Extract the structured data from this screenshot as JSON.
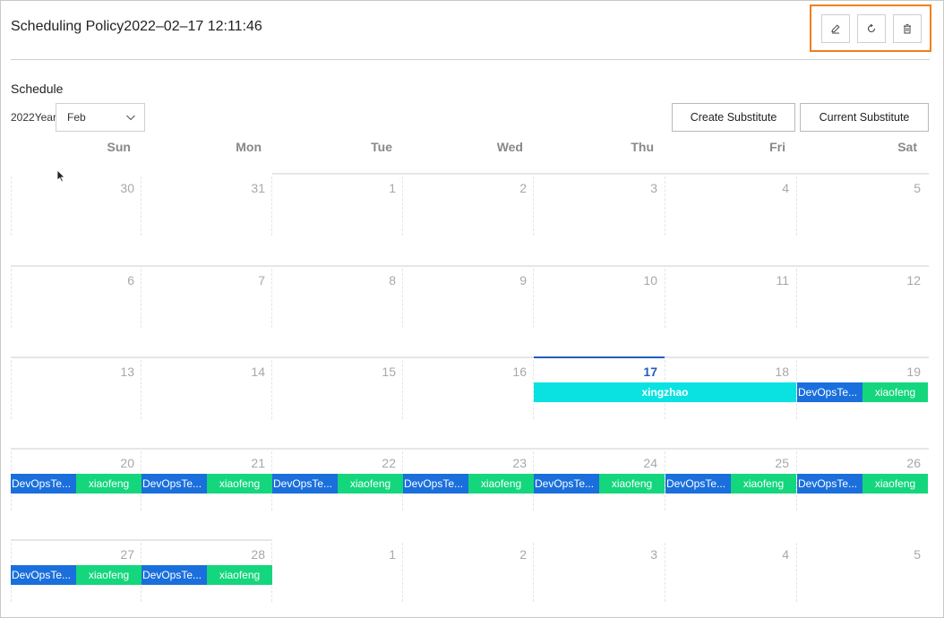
{
  "header": {
    "title": "Scheduling Policy2022–02–17 12:11:46",
    "actions": [
      {
        "name": "edit-button",
        "icon": "edit-icon"
      },
      {
        "name": "refresh-button",
        "icon": "refresh-icon"
      },
      {
        "name": "delete-button",
        "icon": "trash-icon"
      }
    ]
  },
  "schedule": {
    "label": "Schedule",
    "year_label": "2022Years",
    "month_value": "Feb",
    "create_substitute": "Create Substitute",
    "current_substitute": "Current Substitute",
    "weekdays": [
      "Sun",
      "Mon",
      "Tue",
      "Wed",
      "Thu",
      "Fri",
      "Sat"
    ],
    "weeks": [
      [
        "30",
        "31",
        "1",
        "2",
        "3",
        "4",
        "5"
      ],
      [
        "6",
        "7",
        "8",
        "9",
        "10",
        "11",
        "12"
      ],
      [
        "13",
        "14",
        "15",
        "16",
        "17",
        "18",
        "19"
      ],
      [
        "20",
        "21",
        "22",
        "23",
        "24",
        "25",
        "26"
      ],
      [
        "27",
        "28",
        "1",
        "2",
        "3",
        "4",
        "5"
      ]
    ],
    "today": "17",
    "event_team_label": "DevOpsTe...",
    "event_person_label": "xiaofeng",
    "event_xingzhao": "xingzhao"
  },
  "colors": {
    "accent_blue": "#1a6fdc",
    "accent_green": "#14d67d",
    "accent_cyan": "#0ae2e2",
    "highlight_orange": "#f07f1a"
  }
}
